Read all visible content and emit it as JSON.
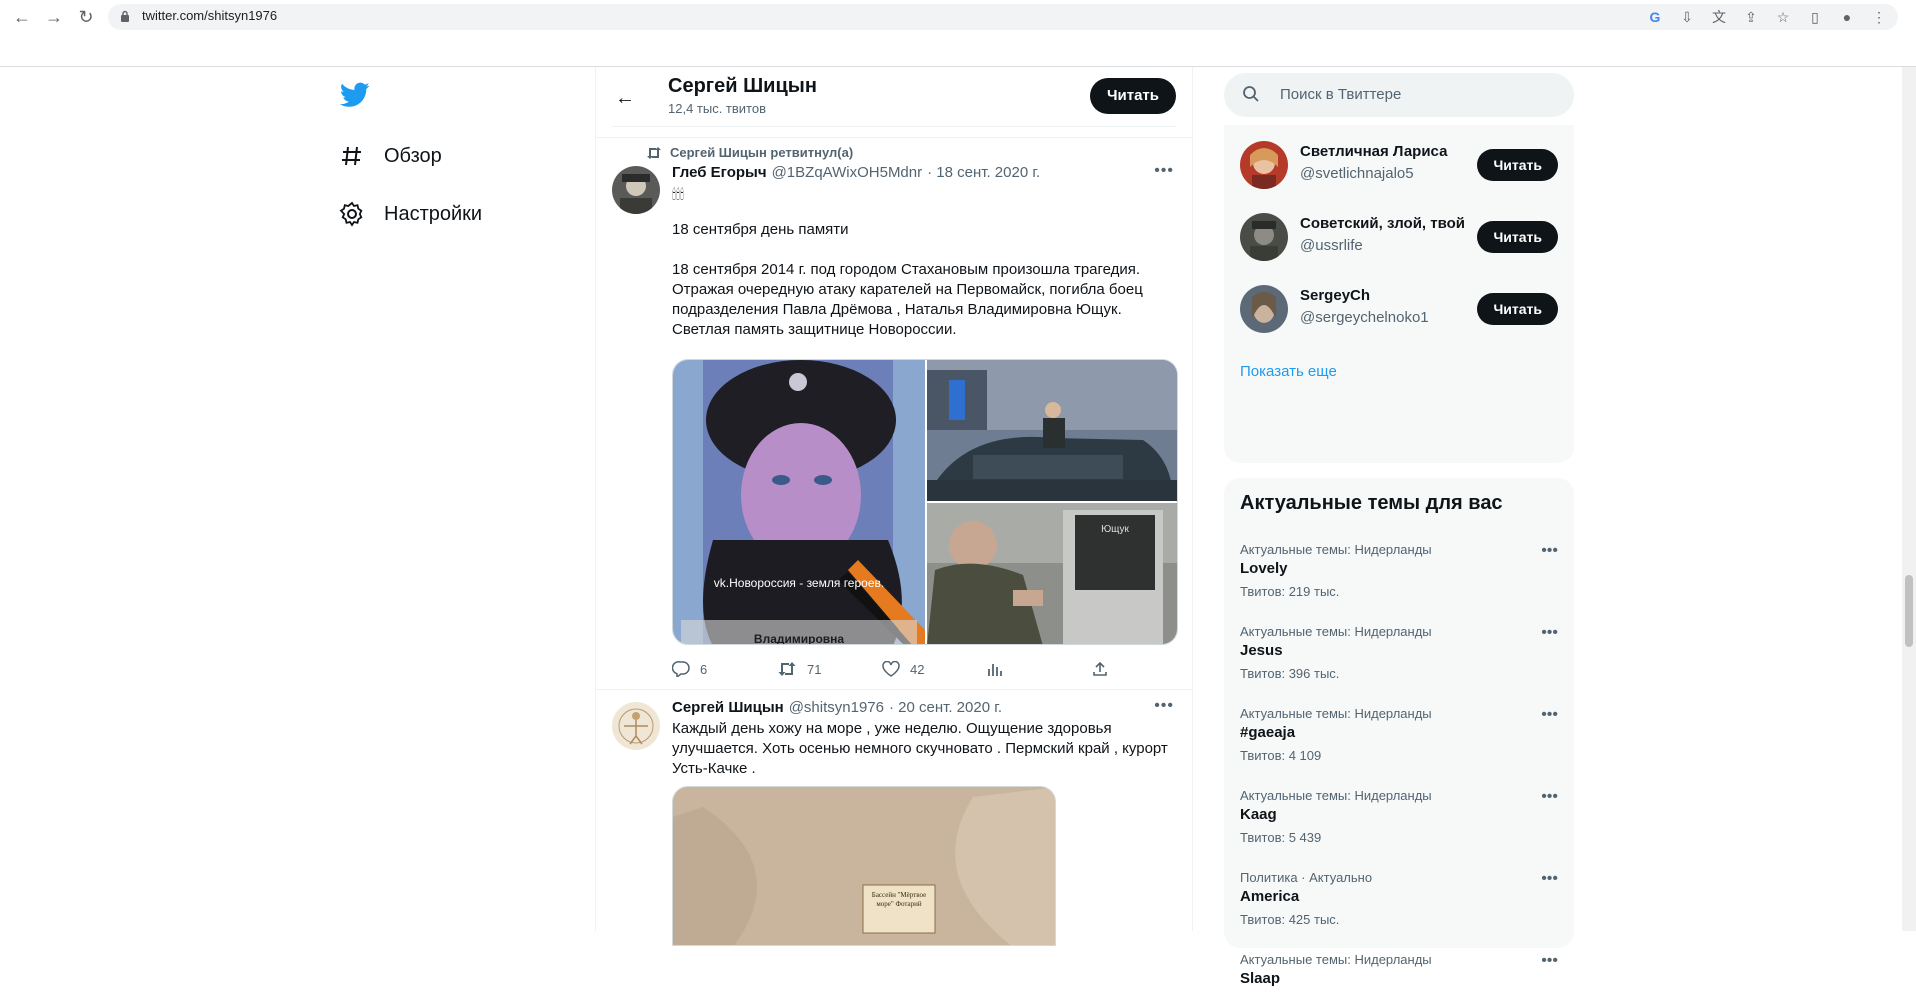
{
  "browser": {
    "url": "twitter.com/shitsyn1976"
  },
  "nav": {
    "items": [
      {
        "label": "Обзор"
      },
      {
        "label": "Настройки"
      }
    ]
  },
  "profile": {
    "name": "Сергей Шицын",
    "tweet_count": "12,4 тыс. твитов",
    "follow_label": "Читать"
  },
  "tweets": [
    {
      "retweet_by": "Сергей Шицын ретвитнул(а)",
      "author_name": "Глеб Егорыч",
      "author_handle": "@1BZqAWixOH5Mdnr",
      "date": "· 18 сент. 2020 г.",
      "emoji": "🕯🕯🕯",
      "text_line1": "18 сентября день памяти",
      "text_para": "18 сентября 2014 г. под городом Стахановым произошла трагедия. Отражая очередную атаку карателей на Первомайск, погибла боец подразделения Павла Дрёмова , Наталья Владимировна Ющук. Светлая память защитнице Новороссии.",
      "image_caption": "vk.Новороссия - земля героев.",
      "image_name_text": "Владимировна",
      "plaque_text": "Ющук",
      "replies": "6",
      "retweets": "71",
      "likes": "42"
    },
    {
      "author_name": "Сергей Шицын",
      "author_handle": "@shitsyn1976",
      "date": "· 20 сент. 2020 г.",
      "text": "Каждый день хожу на море , уже неделю. Ощущение здоровья улучшается. Хоть осенью немного скучновато . Пермский край , курорт Усть-Качке .",
      "image_sign_text": "Бассейн \"Мёртвое море\" Фотарий"
    }
  ],
  "search": {
    "placeholder": "Поиск в Твиттере"
  },
  "who_to_follow": {
    "items": [
      {
        "name": "Светличная Лариса",
        "handle": "@svetlichnajalo5",
        "button": "Читать"
      },
      {
        "name": "Советский, злой, твой",
        "handle": "@ussrlife",
        "button": "Читать"
      },
      {
        "name": "SergeyCh",
        "handle": "@sergeychelnoko1",
        "button": "Читать"
      }
    ],
    "show_more": "Показать еще"
  },
  "trends": {
    "title": "Актуальные темы для вас",
    "items": [
      {
        "context": "Актуальные темы: Нидерланды",
        "title": "Lovely",
        "count": "Твитов: 219 тыс."
      },
      {
        "context": "Актуальные темы: Нидерланды",
        "title": "Jesus",
        "count": "Твитов: 396 тыс."
      },
      {
        "context": "Актуальные темы: Нидерланды",
        "title": "#gaeaja",
        "count": "Твитов: 4 109"
      },
      {
        "context": "Актуальные темы: Нидерланды",
        "title": "Kaag",
        "count": "Твитов: 5 439"
      },
      {
        "context": "Политика · Актуально",
        "title": "America",
        "count": "Твитов: 425 тыс."
      },
      {
        "context": "Актуальные темы: Нидерланды",
        "title": "Slaap",
        "count": ""
      }
    ]
  },
  "colors": {
    "accent": "#1d9bf0",
    "text": "#0f1419",
    "secondary": "#536471"
  }
}
